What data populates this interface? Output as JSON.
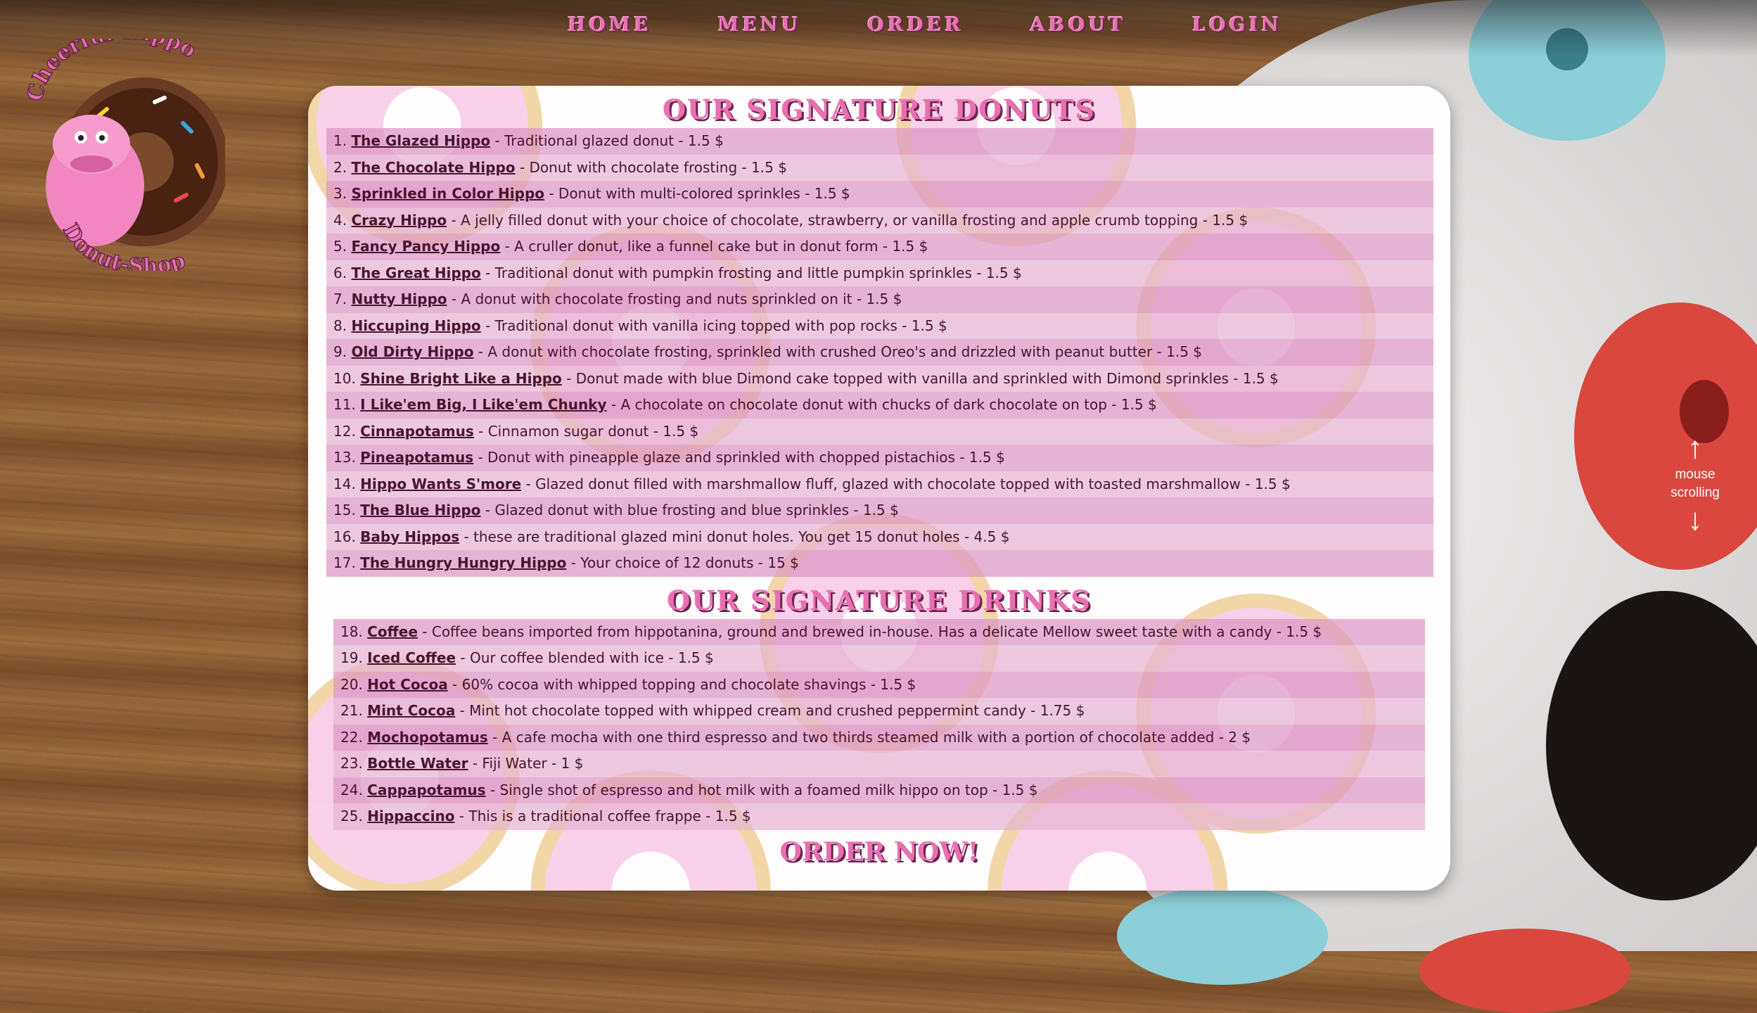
{
  "nav": {
    "items": [
      {
        "label": "HOME"
      },
      {
        "label": "MENU"
      },
      {
        "label": "ORDER"
      },
      {
        "label": "ABOUT"
      },
      {
        "label": "LOGIN"
      }
    ]
  },
  "logo": {
    "top_text": "Cheerful-Hippo",
    "bottom_text": "Donut-Shop"
  },
  "donuts": {
    "title": "OUR SIGNATURE DONUTS",
    "items": [
      {
        "num": "1.",
        "name": "The Glazed Hippo",
        "desc": " - Traditional glazed donut - 1.5 $"
      },
      {
        "num": "2.",
        "name": "The Chocolate Hippo",
        "desc": " - Donut with chocolate frosting - 1.5 $"
      },
      {
        "num": "3.",
        "name": "Sprinkled in Color Hippo",
        "desc": " - Donut with multi-colored sprinkles - 1.5 $"
      },
      {
        "num": "4.",
        "name": "Crazy Hippo",
        "desc": " - A jelly filled donut with your choice of chocolate, strawberry, or vanilla frosting and apple crumb topping - 1.5 $"
      },
      {
        "num": "5.",
        "name": "Fancy Pancy Hippo",
        "desc": " - A cruller donut, like a funnel cake but in donut form - 1.5 $"
      },
      {
        "num": "6.",
        "name": "The Great Hippo",
        "desc": " - Traditional donut with pumpkin frosting and little pumpkin sprinkles - 1.5 $"
      },
      {
        "num": "7.",
        "name": "Nutty Hippo",
        "desc": " - A donut with chocolate frosting and nuts sprinkled on it - 1.5 $"
      },
      {
        "num": "8.",
        "name": "Hiccuping Hippo",
        "desc": " - Traditional donut with vanilla icing topped with pop rocks - 1.5 $"
      },
      {
        "num": "9.",
        "name": "Old Dirty Hippo",
        "desc": " - A donut with chocolate frosting, sprinkled with crushed Oreo's and drizzled with peanut butter - 1.5 $"
      },
      {
        "num": "10.",
        "name": "Shine Bright Like a Hippo",
        "desc": " - Donut made with blue Dimond cake topped with vanilla and sprinkled with Dimond sprinkles - 1.5 $"
      },
      {
        "num": "11.",
        "name": "I Like'em Big, I Like'em Chunky",
        "desc": " - A chocolate on chocolate donut with chucks of dark chocolate on top - 1.5 $"
      },
      {
        "num": "12.",
        "name": "Cinnapotamus",
        "desc": " - Cinnamon sugar donut - 1.5 $"
      },
      {
        "num": "13.",
        "name": "Pineapotamus",
        "desc": " - Donut with pineapple glaze and sprinkled with chopped pistachios - 1.5 $"
      },
      {
        "num": "14.",
        "name": "Hippo Wants S'more",
        "desc": " - Glazed donut filled with marshmallow fluff, glazed with chocolate topped with toasted marshmallow - 1.5 $"
      },
      {
        "num": "15.",
        "name": "The Blue Hippo",
        "desc": " - Glazed donut with blue frosting and blue sprinkles - 1.5 $"
      },
      {
        "num": "16.",
        "name": "Baby Hippos",
        "desc": " - these are traditional glazed mini donut holes. You get 15 donut holes - 4.5 $"
      },
      {
        "num": "17.",
        "name": "The Hungry Hungry Hippo",
        "desc": " - Your choice of 12 donuts - 15 $"
      }
    ]
  },
  "drinks": {
    "title": "OUR SIGNATURE DRINKS",
    "items": [
      {
        "num": "18.",
        "name": "Coffee",
        "desc": " - Coffee beans imported from hippotanina, ground and brewed in-house. Has a delicate Mellow sweet taste with a candy - 1.5 $"
      },
      {
        "num": "19.",
        "name": "Iced Coffee",
        "desc": " - Our coffee blended with ice - 1.5 $"
      },
      {
        "num": "20.",
        "name": "Hot Cocoa",
        "desc": " - 60% cocoa with whipped topping and chocolate shavings - 1.5 $"
      },
      {
        "num": "21.",
        "name": "Mint Cocoa",
        "desc": " - Mint hot chocolate topped with whipped cream and crushed peppermint candy - 1.75 $"
      },
      {
        "num": "22.",
        "name": "Mochopotamus",
        "desc": " - A cafe mocha with one third espresso and two thirds steamed milk with a portion of chocolate added - 2 $"
      },
      {
        "num": "23.",
        "name": "Bottle Water",
        "desc": " - Fiji Water - 1 $"
      },
      {
        "num": "24.",
        "name": "Cappapotamus",
        "desc": " - Single shot of espresso and hot milk with a foamed milk hippo on top - 1.5 $"
      },
      {
        "num": "25.",
        "name": "Hippaccino",
        "desc": " - This is a traditional coffee frappe - 1.5 $"
      }
    ]
  },
  "order_now": "ORDER NOW!",
  "scroll_hint": {
    "line1": "mouse",
    "line2": "scrolling",
    "up_icon": "↑",
    "down_icon": "↓"
  }
}
